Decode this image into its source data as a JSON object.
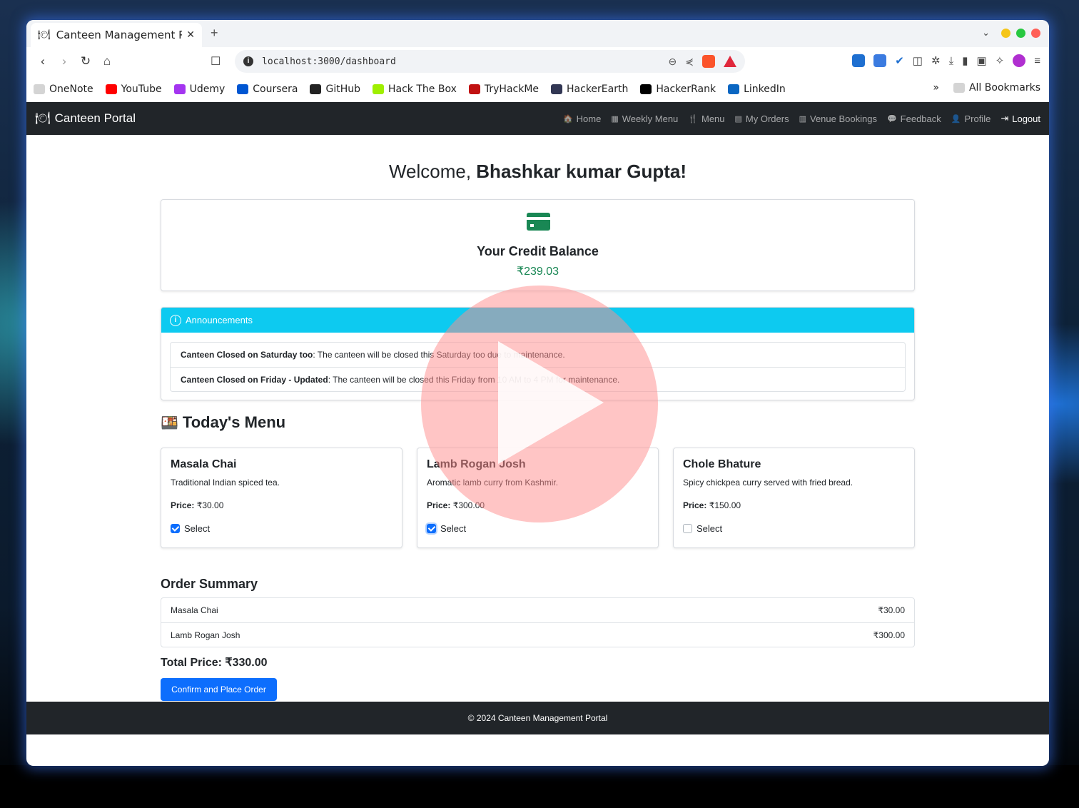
{
  "browser": {
    "tab_title": "Canteen Management P",
    "new_tab": "+",
    "url": "localhost:3000/dashboard",
    "bookmarks": [
      {
        "label": "OneNote",
        "color": "#d4d4d4"
      },
      {
        "label": "YouTube",
        "color": "#ff0000"
      },
      {
        "label": "Udemy",
        "color": "#a435f0"
      },
      {
        "label": "Coursera",
        "color": "#0056d2"
      },
      {
        "label": "GitHub",
        "color": "#222222"
      },
      {
        "label": "Hack The Box",
        "color": "#9fef00"
      },
      {
        "label": "TryHackMe",
        "color": "#c11111"
      },
      {
        "label": "HackerEarth",
        "color": "#323754"
      },
      {
        "label": "HackerRank",
        "color": "#000000"
      },
      {
        "label": "LinkedIn",
        "color": "#0a66c2"
      }
    ],
    "overflow": "»",
    "all_bookmarks": "All Bookmarks"
  },
  "nav": {
    "brand": "Canteen Portal",
    "links": [
      "Home",
      "Weekly Menu",
      "Menu",
      "My Orders",
      "Venue Bookings",
      "Feedback",
      "Profile"
    ],
    "logout": "Logout"
  },
  "main": {
    "welcome_prefix": "Welcome, ",
    "user_name": "Bhashkar kumar Gupta",
    "welcome_suffix": "!",
    "credit_title": "Your Credit Balance",
    "credit_value": "₹239.03",
    "announcements_title": "Announcements",
    "announcements": [
      {
        "title": "Canteen Closed on Saturday too",
        "body": ": The canteen will be closed this Saturday too due to maintenance."
      },
      {
        "title": "Canteen Closed on Friday - Updated",
        "body": ": The canteen will be closed this Friday from 10 AM to 4 PM for maintenance."
      }
    ],
    "menu_title": "Today's Menu",
    "price_label": "Price:",
    "select_label": "Select",
    "menu_items": [
      {
        "name": "Masala Chai",
        "desc": "Traditional Indian spiced tea.",
        "price": "₹30.00",
        "selected": true
      },
      {
        "name": "Lamb Rogan Josh",
        "desc": "Aromatic lamb curry from Kashmir.",
        "price": "₹300.00",
        "selected": true
      },
      {
        "name": "Chole Bhature",
        "desc": "Spicy chickpea curry served with fried bread.",
        "price": "₹150.00",
        "selected": false
      }
    ],
    "summary_title": "Order Summary",
    "summary": [
      {
        "name": "Masala Chai",
        "price": "₹30.00"
      },
      {
        "name": "Lamb Rogan Josh",
        "price": "₹300.00"
      }
    ],
    "total": "Total Price: ₹330.00",
    "confirm_button": "Confirm and Place Order"
  },
  "footer": "© 2024 Canteen Management Portal",
  "colors": {
    "accent": "#0d6efd",
    "success": "#198754",
    "info": "#0dcaf0",
    "navbar": "#212529"
  }
}
